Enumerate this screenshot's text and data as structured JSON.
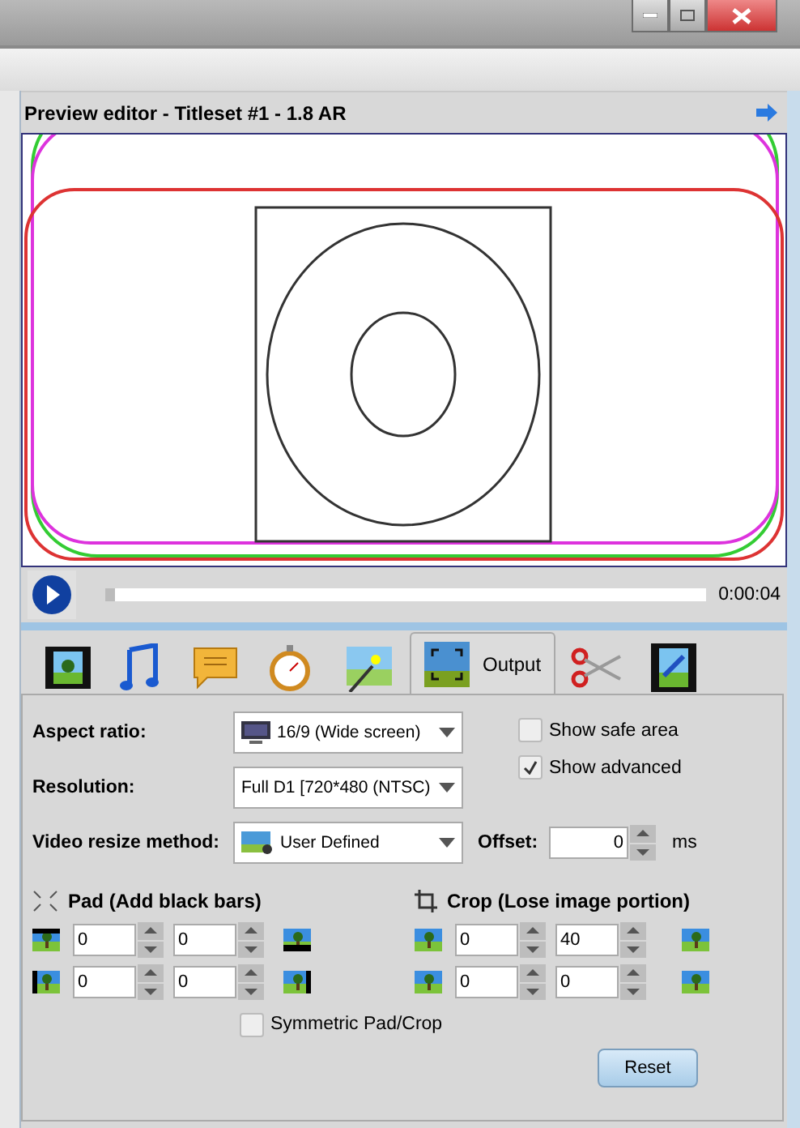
{
  "panel": {
    "title": "Preview editor - Titleset #1 - 1.8 AR"
  },
  "player": {
    "level": 0,
    "time": "0:00:04"
  },
  "tabs": [
    {
      "selected": false
    },
    {
      "selected": false
    },
    {
      "selected": false
    },
    {
      "selected": false
    },
    {
      "selected": false
    },
    {
      "label": "Output",
      "selected": true
    },
    {
      "selected": false
    },
    {
      "selected": false
    }
  ],
  "form": {
    "aspect_ratio": {
      "label": "Aspect ratio:",
      "value": "16/9 (Wide screen)"
    },
    "resolution": {
      "label": "Resolution:",
      "value": "Full D1 [720*480 (NTSC)"
    },
    "resize_method": {
      "label": "Video resize method:",
      "value": "User Defined"
    },
    "offset": {
      "label": "Offset:",
      "value": "0",
      "unit": "ms"
    },
    "checkboxes": [
      {
        "label": "Show safe area",
        "checked": false
      },
      {
        "label": "Show advanced",
        "checked": true
      }
    ],
    "pad": {
      "title": "Pad (Add black bars)",
      "rows": [
        [
          "0",
          "0"
        ],
        [
          "0",
          "0"
        ]
      ]
    },
    "crop": {
      "title": "Crop (Lose image portion)",
      "rows": [
        [
          "0",
          "40"
        ],
        [
          "0",
          "0"
        ]
      ]
    },
    "symmetric": {
      "label": "Symmetric Pad/Crop",
      "checked": false
    },
    "reset": "Reset"
  }
}
